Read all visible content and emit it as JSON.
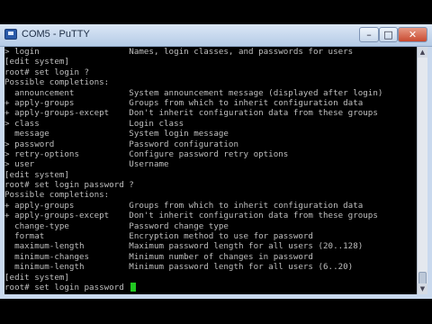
{
  "window": {
    "title": "COM5 - PuTTY",
    "controls": {
      "minimize": "–",
      "maximize": "□",
      "close": "✕"
    }
  },
  "icons": {
    "app": "putty-icon",
    "scroll_up": "arrow-up-icon",
    "scroll_down": "arrow-down-icon"
  },
  "terminal": {
    "lines": [
      "> login                  Names, login classes, and passwords for users",
      "[edit system]",
      "root# set login ?",
      "Possible completions:",
      "  announcement           System announcement message (displayed after login)",
      "+ apply-groups           Groups from which to inherit configuration data",
      "+ apply-groups-except    Don't inherit configuration data from these groups",
      "> class                  Login class",
      "  message                System login message",
      "> password               Password configuration",
      "> retry-options          Configure password retry options",
      "> user                   Username",
      "[edit system]",
      "root# set login password ?",
      "Possible completions:",
      "+ apply-groups           Groups from which to inherit configuration data",
      "+ apply-groups-except    Don't inherit configuration data from these groups",
      "  change-type            Password change type",
      "  format                 Encryption method to use for password",
      "  maximum-length         Maximum password length for all users (20..128)",
      "  minimum-changes        Minimum number of changes in password",
      "  minimum-length         Minimum password length for all users (6..20)",
      "[edit system]"
    ],
    "prompt_line": "root# set login password ",
    "cursor_color": "#21c821"
  }
}
